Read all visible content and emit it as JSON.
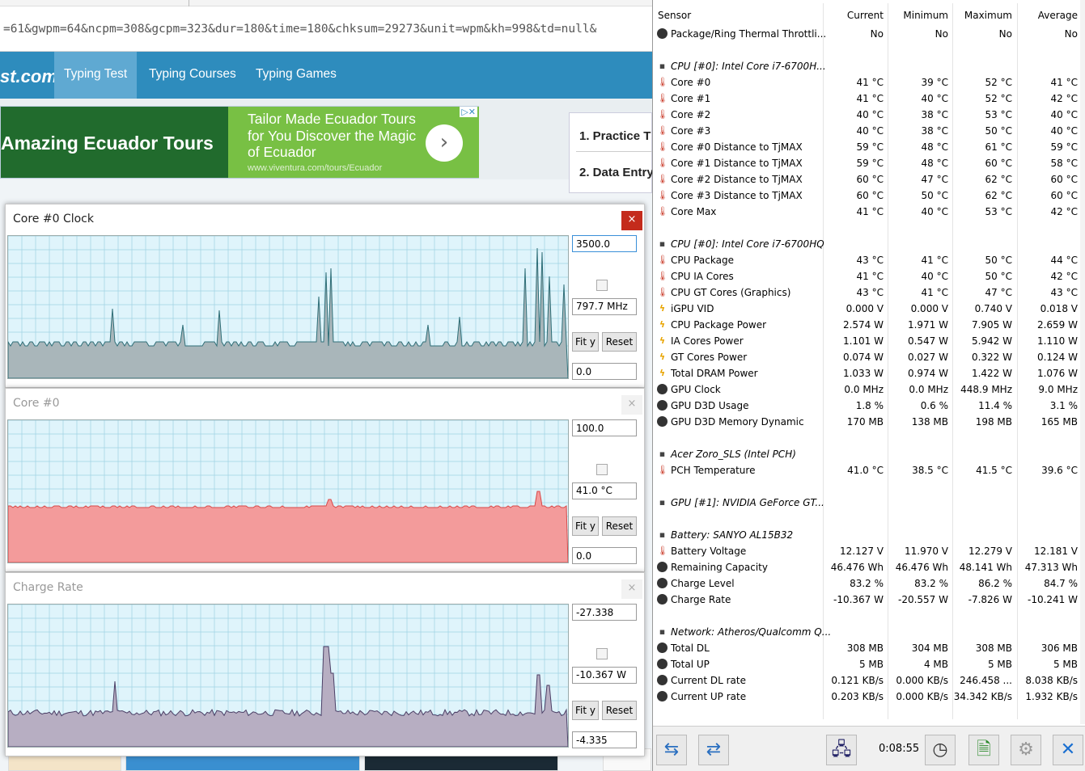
{
  "browser": {
    "url": "=61&gwpm=64&ncpm=308&gcpm=323&dur=180&time=180&chksum=29273&unit=wpm&kh=998&td=null&",
    "logo": "st.com",
    "nav": [
      "Typing Test",
      "Typing Courses",
      "Typing Games"
    ],
    "ad": {
      "left_text": "Amazing Ecuador Tours",
      "headline": "Tailor Made Ecuador Tours for You Discover the Magic of Ecuador",
      "url": "www.viventura.com/tours/Ecuador",
      "arrow": "›",
      "choices": "▷✕"
    },
    "practice": [
      "1. Practice T",
      "2. Data Entry"
    ]
  },
  "graphs": [
    {
      "title": "Core #0 Clock",
      "top_value": "3500.0",
      "current": "797.7 MHz",
      "bottom_value": "0.0",
      "fit_label": "Fit y",
      "reset_label": "Reset",
      "close": "×"
    },
    {
      "title": "Core #0",
      "top_value": "100.0",
      "current": "41.0 °C",
      "bottom_value": "0.0",
      "fit_label": "Fit y",
      "reset_label": "Reset",
      "close": "×"
    },
    {
      "title": "Charge Rate",
      "top_value": "-27.338",
      "current": "-10.367 W",
      "bottom_value": "-4.335",
      "fit_label": "Fit y",
      "reset_label": "Reset",
      "close": "×"
    }
  ],
  "sensors": {
    "headers": [
      "Sensor",
      "Current",
      "Minimum",
      "Maximum",
      "Average"
    ],
    "rows": [
      {
        "icon": "cir",
        "label": "Package/Ring Thermal Throttli...",
        "values": [
          "No",
          "No",
          "No",
          "No"
        ]
      },
      {
        "icon": "",
        "label": "",
        "values": [
          "",
          "",
          "",
          ""
        ]
      },
      {
        "icon": "chip",
        "label": "CPU [#0]: Intel Core i7-6700H...",
        "group": true,
        "values": [
          "",
          "",
          "",
          ""
        ]
      },
      {
        "icon": "therm",
        "label": "Core #0",
        "values": [
          "41 °C",
          "39 °C",
          "52 °C",
          "41 °C"
        ]
      },
      {
        "icon": "therm",
        "label": "Core #1",
        "values": [
          "41 °C",
          "40 °C",
          "52 °C",
          "42 °C"
        ]
      },
      {
        "icon": "therm",
        "label": "Core #2",
        "values": [
          "40 °C",
          "38 °C",
          "53 °C",
          "40 °C"
        ]
      },
      {
        "icon": "therm",
        "label": "Core #3",
        "values": [
          "40 °C",
          "38 °C",
          "50 °C",
          "40 °C"
        ]
      },
      {
        "icon": "therm",
        "label": "Core #0 Distance to TjMAX",
        "values": [
          "59 °C",
          "48 °C",
          "61 °C",
          "59 °C"
        ]
      },
      {
        "icon": "therm",
        "label": "Core #1 Distance to TjMAX",
        "values": [
          "59 °C",
          "48 °C",
          "60 °C",
          "58 °C"
        ]
      },
      {
        "icon": "therm",
        "label": "Core #2 Distance to TjMAX",
        "values": [
          "60 °C",
          "47 °C",
          "62 °C",
          "60 °C"
        ]
      },
      {
        "icon": "therm",
        "label": "Core #3 Distance to TjMAX",
        "values": [
          "60 °C",
          "50 °C",
          "62 °C",
          "60 °C"
        ]
      },
      {
        "icon": "therm",
        "label": "Core Max",
        "values": [
          "41 °C",
          "40 °C",
          "53 °C",
          "42 °C"
        ]
      },
      {
        "icon": "",
        "label": "",
        "values": [
          "",
          "",
          "",
          ""
        ]
      },
      {
        "icon": "chip",
        "label": "CPU [#0]: Intel Core i7-6700HQ",
        "group": true,
        "values": [
          "",
          "",
          "",
          ""
        ]
      },
      {
        "icon": "therm",
        "label": "CPU Package",
        "values": [
          "43 °C",
          "41 °C",
          "50 °C",
          "44 °C"
        ]
      },
      {
        "icon": "therm",
        "label": "CPU IA Cores",
        "values": [
          "41 °C",
          "40 °C",
          "50 °C",
          "42 °C"
        ]
      },
      {
        "icon": "therm",
        "label": "CPU GT Cores (Graphics)",
        "values": [
          "43 °C",
          "41 °C",
          "47 °C",
          "43 °C"
        ]
      },
      {
        "icon": "bolt",
        "label": "iGPU VID",
        "values": [
          "0.000 V",
          "0.000 V",
          "0.740 V",
          "0.018 V"
        ]
      },
      {
        "icon": "bolt",
        "label": "CPU Package Power",
        "values": [
          "2.574 W",
          "1.971 W",
          "7.905 W",
          "2.659 W"
        ]
      },
      {
        "icon": "bolt",
        "label": "IA Cores Power",
        "values": [
          "1.101 W",
          "0.547 W",
          "5.942 W",
          "1.110 W"
        ]
      },
      {
        "icon": "bolt",
        "label": "GT Cores Power",
        "values": [
          "0.074 W",
          "0.027 W",
          "0.322 W",
          "0.124 W"
        ]
      },
      {
        "icon": "bolt",
        "label": "Total DRAM Power",
        "values": [
          "1.033 W",
          "0.974 W",
          "1.422 W",
          "1.076 W"
        ]
      },
      {
        "icon": "cir",
        "label": "GPU Clock",
        "values": [
          "0.0 MHz",
          "0.0 MHz",
          "448.9 MHz",
          "9.0 MHz"
        ]
      },
      {
        "icon": "cir",
        "label": "GPU D3D Usage",
        "values": [
          "1.8 %",
          "0.6 %",
          "11.4 %",
          "3.1 %"
        ]
      },
      {
        "icon": "cir",
        "label": "GPU D3D Memory Dynamic",
        "values": [
          "170 MB",
          "138 MB",
          "198 MB",
          "165 MB"
        ]
      },
      {
        "icon": "",
        "label": "",
        "values": [
          "",
          "",
          "",
          ""
        ]
      },
      {
        "icon": "chip",
        "label": "Acer Zoro_SLS (Intel PCH)",
        "group": true,
        "values": [
          "",
          "",
          "",
          ""
        ]
      },
      {
        "icon": "therm",
        "label": "PCH Temperature",
        "values": [
          "41.0 °C",
          "38.5 °C",
          "41.5 °C",
          "39.6 °C"
        ]
      },
      {
        "icon": "",
        "label": "",
        "values": [
          "",
          "",
          "",
          ""
        ]
      },
      {
        "icon": "chip",
        "label": "GPU [#1]: NVIDIA GeForce GT...",
        "group": true,
        "values": [
          "",
          "",
          "",
          ""
        ]
      },
      {
        "icon": "",
        "label": "",
        "values": [
          "",
          "",
          "",
          ""
        ]
      },
      {
        "icon": "chip",
        "label": "Battery: SANYO AL15B32",
        "group": true,
        "values": [
          "",
          "",
          "",
          ""
        ]
      },
      {
        "icon": "therm",
        "label": "Battery Voltage",
        "values": [
          "12.127 V",
          "11.970 V",
          "12.279 V",
          "12.181 V"
        ]
      },
      {
        "icon": "cir",
        "label": "Remaining Capacity",
        "values": [
          "46.476 Wh",
          "46.476 Wh",
          "48.141 Wh",
          "47.313 Wh"
        ]
      },
      {
        "icon": "cir",
        "label": "Charge Level",
        "values": [
          "83.2 %",
          "83.2 %",
          "86.2 %",
          "84.7 %"
        ]
      },
      {
        "icon": "cir",
        "label": "Charge Rate",
        "values": [
          "-10.367 W",
          "-20.557 W",
          "-7.826 W",
          "-10.241 W"
        ]
      },
      {
        "icon": "",
        "label": "",
        "values": [
          "",
          "",
          "",
          ""
        ]
      },
      {
        "icon": "chip",
        "label": "Network: Atheros/Qualcomm Q...",
        "group": true,
        "values": [
          "",
          "",
          "",
          ""
        ]
      },
      {
        "icon": "cir",
        "label": "Total DL",
        "values": [
          "308 MB",
          "304 MB",
          "308 MB",
          "306 MB"
        ]
      },
      {
        "icon": "cir",
        "label": "Total UP",
        "values": [
          "5 MB",
          "4 MB",
          "5 MB",
          "5 MB"
        ]
      },
      {
        "icon": "cir",
        "label": "Current DL rate",
        "values": [
          "0.121 KB/s",
          "0.000 KB/s",
          "246.458 ...",
          "8.038 KB/s"
        ]
      },
      {
        "icon": "cir",
        "label": "Current UP rate",
        "values": [
          "0.203 KB/s",
          "0.000 KB/s",
          "34.342 KB/s",
          "1.932 KB/s"
        ]
      }
    ],
    "footer": {
      "timer": "0:08:55"
    }
  }
}
